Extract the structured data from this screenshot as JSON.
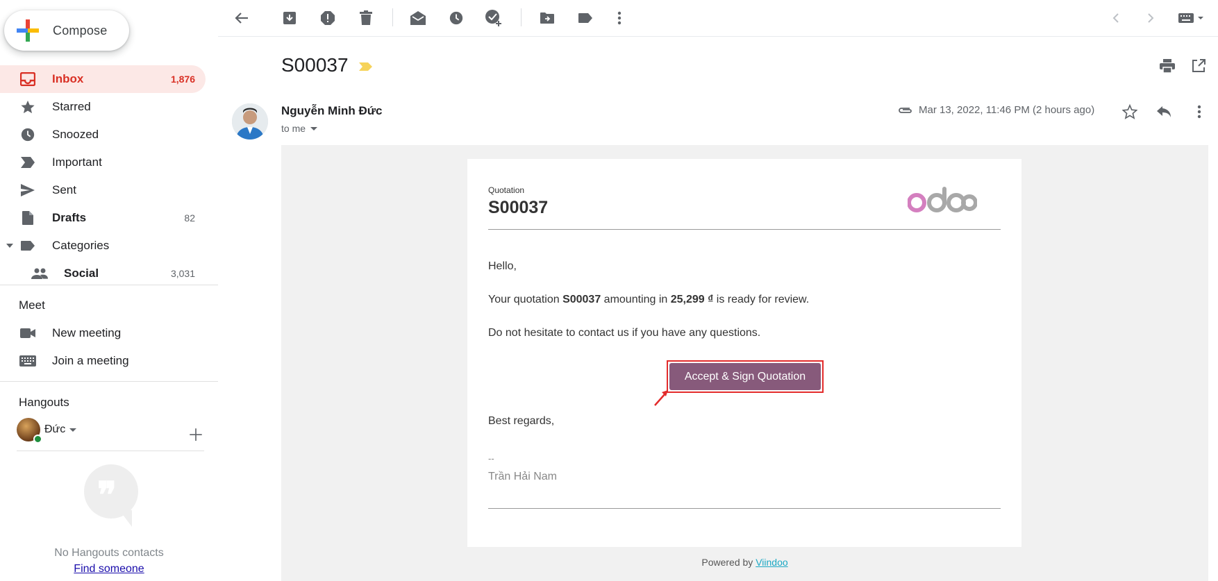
{
  "sidebar": {
    "compose_label": "Compose",
    "items": [
      {
        "label": "Inbox",
        "count": "1,876"
      },
      {
        "label": "Starred",
        "count": ""
      },
      {
        "label": "Snoozed",
        "count": ""
      },
      {
        "label": "Important",
        "count": ""
      },
      {
        "label": "Sent",
        "count": ""
      },
      {
        "label": "Drafts",
        "count": "82"
      },
      {
        "label": "Categories",
        "count": ""
      },
      {
        "label": "Social",
        "count": "3,031"
      }
    ],
    "meet": {
      "title": "Meet",
      "new_meeting": "New meeting",
      "join_meeting": "Join a meeting"
    },
    "hangouts": {
      "title": "Hangouts",
      "user_name": "Đức",
      "no_contacts": "No Hangouts contacts",
      "find_someone": "Find someone"
    }
  },
  "message": {
    "subject": "S00037",
    "sender_name": "Nguyễn Minh Đức",
    "to": "to me",
    "date": "Mar 13, 2022, 11:46 PM (2 hours ago)"
  },
  "email": {
    "quotation_label": "Quotation",
    "quotation_number": "S00037",
    "logo_text": "odoo",
    "greeting": "Hello,",
    "line1_prefix": "Your quotation ",
    "line1_ref": "S00037",
    "line1_mid": " amounting in ",
    "line1_amount": "25,299 ₫",
    "line1_suffix": " is ready for review.",
    "line2": "Do not hesitate to contact us if you have any questions.",
    "button_label": "Accept & Sign Quotation",
    "regards": "Best regards,",
    "signature_dash": "--",
    "signature_name": "Trần Hải Nam",
    "powered_prefix": "Powered by ",
    "powered_link": "Viindoo"
  },
  "colors": {
    "accent_red": "#d93025",
    "odoo_purple": "#875a7b",
    "highlight_box": "#e32b2b",
    "link_teal": "#1ba8c4",
    "label_yellow": "#f6d35a"
  },
  "icons": [
    "back-arrow-icon",
    "archive-icon",
    "report-spam-icon",
    "delete-icon",
    "mark-unread-icon",
    "snooze-icon",
    "add-task-icon",
    "move-to-icon",
    "label-icon",
    "more-vert-icon",
    "chevron-left-icon",
    "chevron-right-icon",
    "keyboard-icon",
    "print-icon",
    "open-new-window-icon",
    "star-icon",
    "reply-icon",
    "attachment-icon"
  ]
}
